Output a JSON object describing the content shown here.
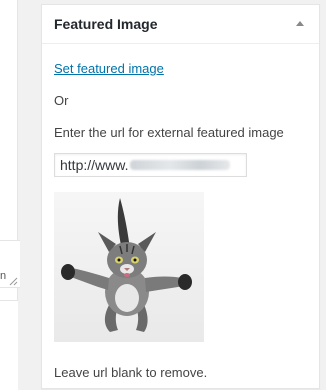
{
  "left_panel": {
    "corner_label": "n"
  },
  "featured_image": {
    "title": "Featured Image",
    "set_link": "Set featured image",
    "or_text": "Or",
    "instruction": "Enter the url for external featured image",
    "url_value": "http://www.",
    "image_alt": "Flying kitten",
    "remove_hint": "Leave url blank to remove."
  },
  "colors": {
    "link": "#0073aa",
    "title": "#23282d",
    "background": "#f1f1f1",
    "panel": "#ffffff"
  },
  "icons": {
    "toggle": "triangle-up-icon",
    "resize": "resize-handle-icon"
  }
}
